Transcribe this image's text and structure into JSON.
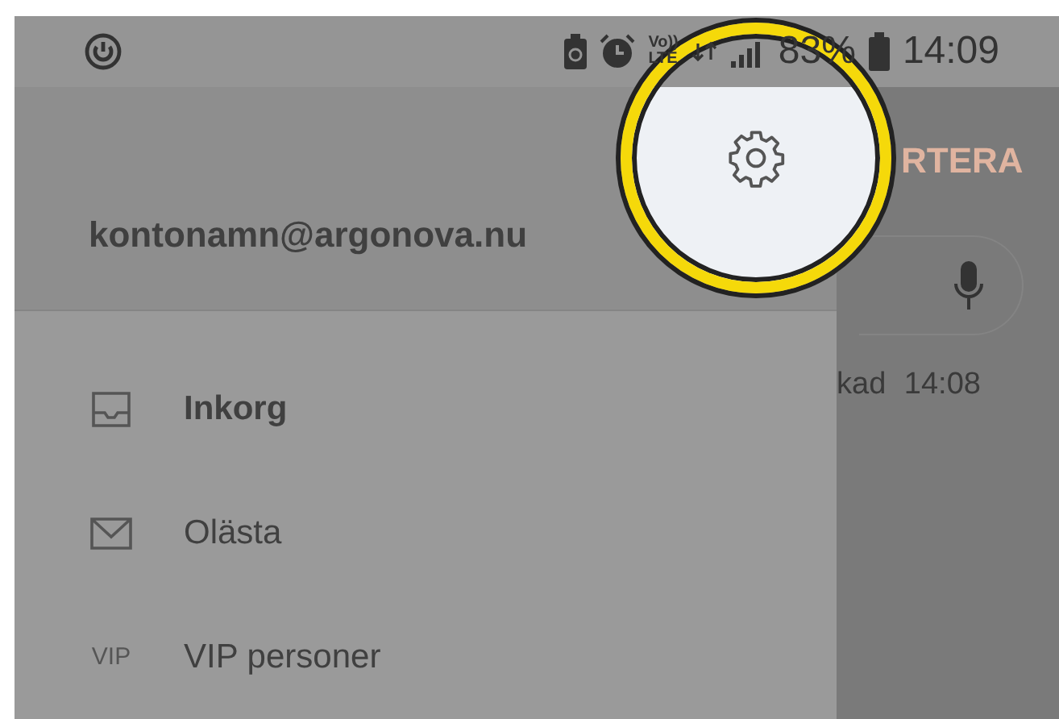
{
  "status_bar": {
    "network_top": "Vo))",
    "network_bottom": "LTE",
    "battery": "83%",
    "time": "14:09"
  },
  "drawer": {
    "account": "kontonamn@argonova.nu",
    "items": [
      {
        "label": "Inkorg",
        "kind": "inbox",
        "selected": true
      },
      {
        "label": "Olästa",
        "kind": "envelope",
        "selected": false
      },
      {
        "label": "VIP personer",
        "kind": "vip",
        "icon_text": "VIP",
        "selected": false
      }
    ]
  },
  "background": {
    "sort_button": "RTERA",
    "status_text": "kad 14:08"
  }
}
